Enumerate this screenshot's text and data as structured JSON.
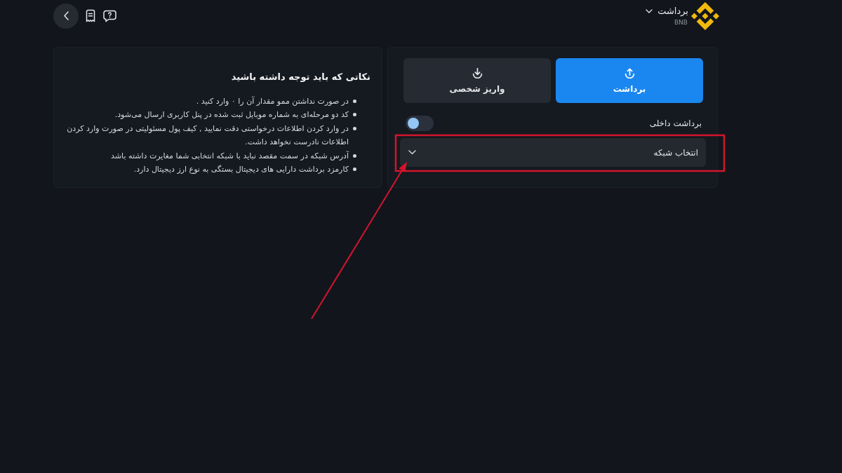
{
  "header": {
    "title": "برداشت",
    "asset": "BNB"
  },
  "withdraw_panel": {
    "tabs": [
      {
        "kind": "withdraw",
        "label": "برداشت",
        "selected": true
      },
      {
        "kind": "deposit",
        "label": "واریز شخصی",
        "selected": false
      }
    ],
    "internal_withdraw": {
      "label": "برداشت داخلی",
      "on": false
    },
    "network_select": {
      "placeholder": "انتخاب شبکه"
    }
  },
  "notes": {
    "title": "نکاتی که باید توجه داشته باشید",
    "items": [
      "در صورت نداشتن ممو مقدار آن را ۰ وارد کنید .",
      "کد دو مرحله‌ای به شماره موبایل ثبت شده در پنل کاربری ارسال می‌شود.",
      "در وارد کردن اطلاعات درخواستی دقت نمایید , کیف پول مسئولیتی در صورت وارد کردن اطلاعات نادرست نخواهد داشت.",
      "آدرس شبکه در سمت مقصد نباید با شبکه انتخابی شما مغایرت داشته باشد",
      "کارمزد برداشت دارایی های دیجیتال بستگی به نوع ارز دیجیتال دارد."
    ]
  }
}
